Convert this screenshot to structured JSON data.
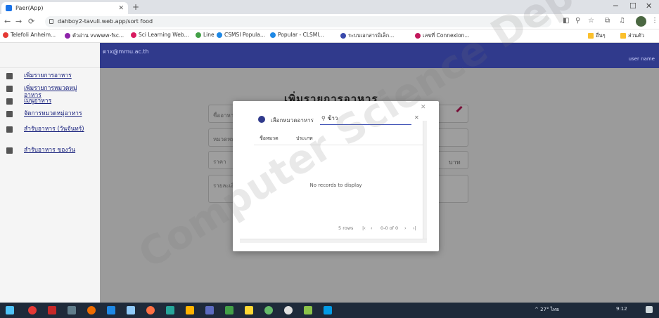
{
  "browser": {
    "tab_title": "Paer(App)",
    "url": "dahboy2-tavuli.web.app/sort food",
    "bookmarks": [
      {
        "label": "Telefoli Anheim...",
        "color": "#e53935"
      },
      {
        "label": "ตัวอ่าน vvwww-fsc...",
        "color": "#8e24aa"
      },
      {
        "label": "Sci Learning Web...",
        "color": "#d81b60"
      },
      {
        "label": "Line",
        "color": "#43a047"
      },
      {
        "label": "CSMSI Popula...",
        "color": "#1e88e5"
      },
      {
        "label": "Popular - CLSMI...",
        "color": "#1e88e5"
      },
      {
        "label": "ระบบเอกสารอิเล็ก...",
        "color": "#3949ab"
      },
      {
        "label": "เลขที่ Connexion...",
        "color": "#c2185b"
      },
      {
        "label": "อื่นๆ",
        "color": "#fbc02d"
      },
      {
        "label": "ส่วนตัว",
        "color": "#fbc02d"
      }
    ]
  },
  "app": {
    "header_brand": "ดาx@mmu.ac.th",
    "header_user": "user name",
    "sidebar_items": [
      {
        "label": "เพิ่มรายการอาหาร"
      },
      {
        "label": "เพิ่มรายการหมวดหมู่อาหาร"
      },
      {
        "label": "เมนูอาหาร"
      },
      {
        "label": "จัดการหมวดหมู่อาหาร"
      },
      {
        "label": "สำรับอาหาร (วันจันทร์)"
      },
      {
        "label": "สำรับอาหาร ของวัน"
      }
    ],
    "page_title": "เพิ่มรายการอาหาร",
    "form": {
      "field1": "ชื่ออาหาร",
      "field2": "หมวดหมู่",
      "field3": "ราคา",
      "field3_suffix": "บาท",
      "field4": "รายละเอียด"
    }
  },
  "dialog": {
    "title": "เลือกหมวดอาหาร",
    "search_value": "ข้าว",
    "columns": [
      "ชื่อหมวด",
      "ประเภท"
    ],
    "empty_message": "No records to display",
    "pager": {
      "rows_label": "5 rows",
      "range_label": "0-0 of 0"
    }
  },
  "taskbar": {
    "tray_text": "^ 27° ไทย",
    "clock": "9:12"
  },
  "watermark": "Computer Science Dept Mahasarakham"
}
